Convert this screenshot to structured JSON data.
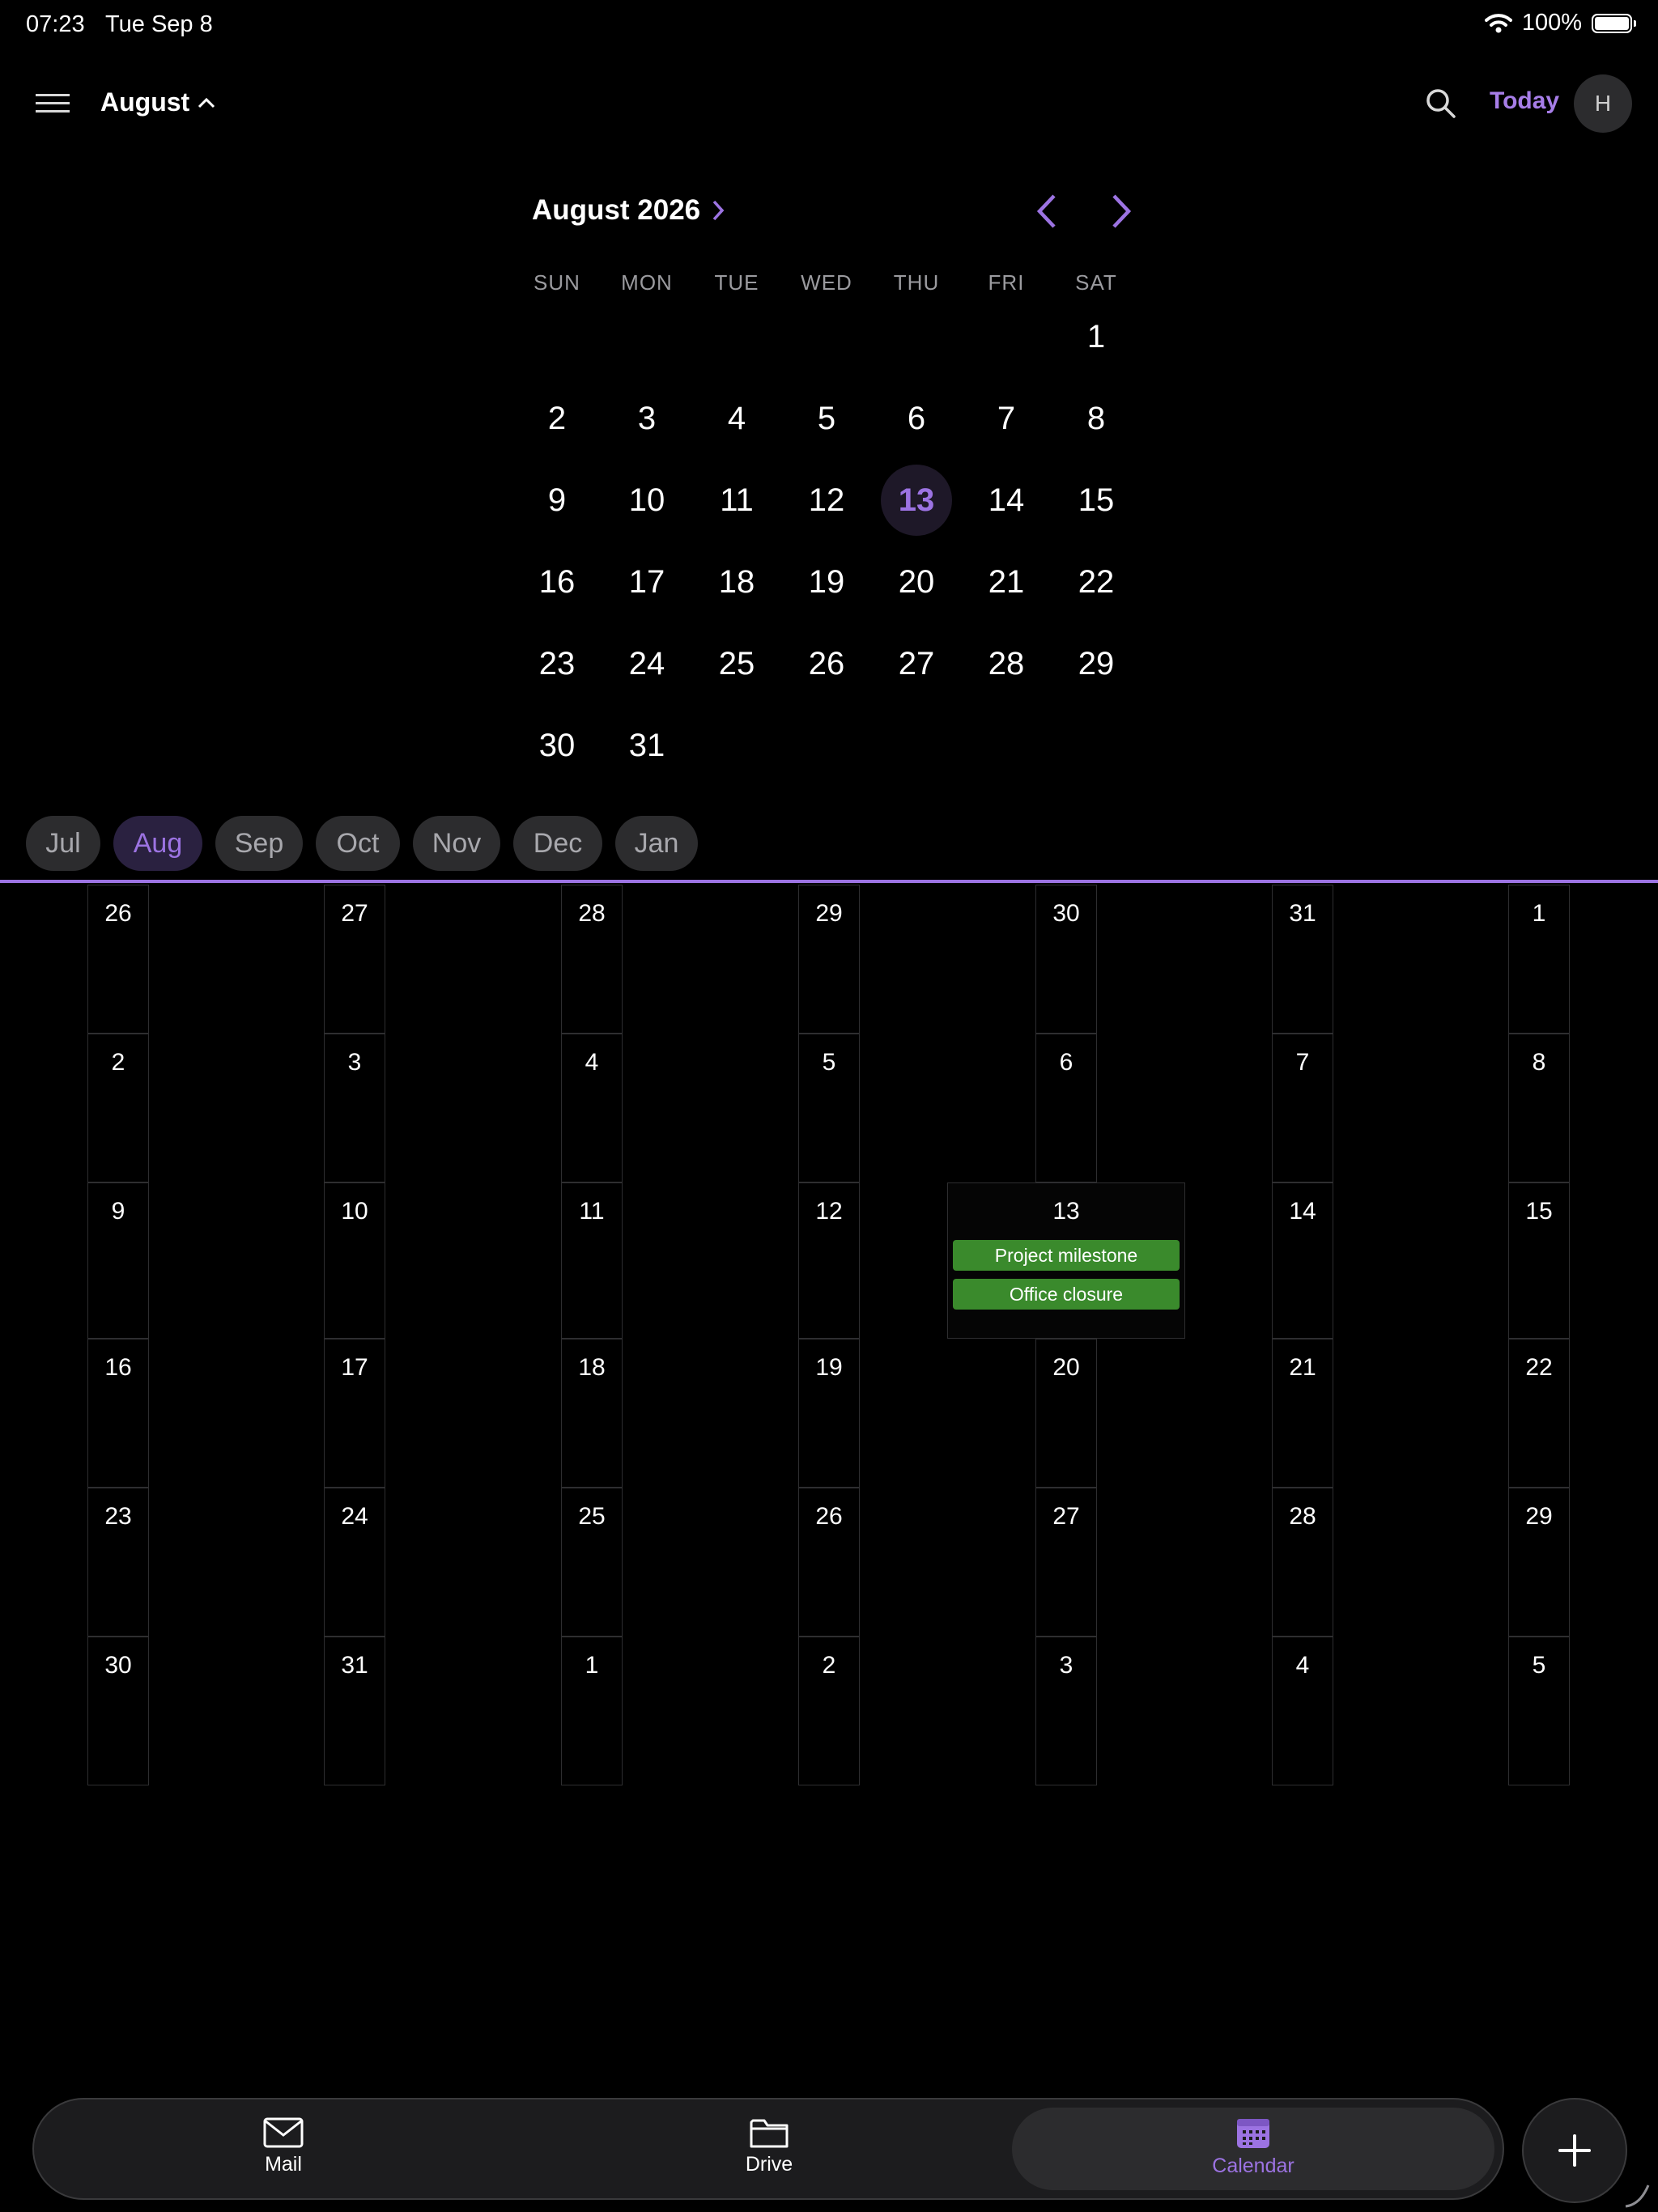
{
  "status": {
    "time": "07:23",
    "date": "Tue Sep 8",
    "battery": "100%"
  },
  "header": {
    "title": "August",
    "today": "Today",
    "avatar": "H"
  },
  "mini": {
    "title": "August 2026",
    "weekdays": [
      "SUN",
      "MON",
      "TUE",
      "WED",
      "THU",
      "FRI",
      "SAT"
    ],
    "days": [
      "1",
      "2",
      "3",
      "4",
      "5",
      "6",
      "7",
      "8",
      "9",
      "10",
      "11",
      "12",
      "13",
      "14",
      "15",
      "16",
      "17",
      "18",
      "19",
      "20",
      "21",
      "22",
      "23",
      "24",
      "25",
      "26",
      "27",
      "28",
      "29",
      "30",
      "31"
    ],
    "selected": "13"
  },
  "months": [
    "Jul",
    "Aug",
    "Sep",
    "Oct",
    "Nov",
    "Dec",
    "Jan"
  ],
  "active_month": "Aug",
  "grid": {
    "weeks": [
      [
        "26",
        "27",
        "28",
        "29",
        "30",
        "31",
        "1"
      ],
      [
        "2",
        "3",
        "4",
        "5",
        "6",
        "7",
        "8"
      ],
      [
        "9",
        "10",
        "11",
        "12",
        "13",
        "14",
        "15"
      ],
      [
        "16",
        "17",
        "18",
        "19",
        "20",
        "21",
        "22"
      ],
      [
        "23",
        "24",
        "25",
        "26",
        "27",
        "28",
        "29"
      ],
      [
        "30",
        "31",
        "1",
        "2",
        "3",
        "4",
        "5"
      ]
    ],
    "events": [
      "Project milestone",
      "Office closure"
    ],
    "event_color": "#3a8a2c"
  },
  "nav": {
    "mail": "Mail",
    "drive": "Drive",
    "calendar": "Calendar"
  },
  "colors": {
    "accent": "#9c73e2",
    "background": "#000000"
  }
}
